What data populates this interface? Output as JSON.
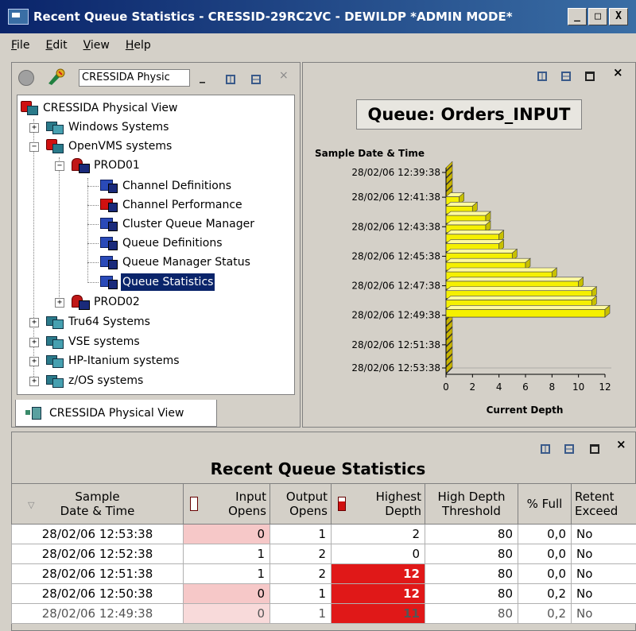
{
  "window": {
    "title": "Recent Queue Statistics - CRESSID-29RC2VC - DEWILDP   *ADMIN MODE*",
    "buttons": [
      "_",
      "□",
      "X"
    ]
  },
  "menu": [
    "File",
    "Edit",
    "View",
    "Help"
  ],
  "left_panel": {
    "view_selector": "CRESSIDA Physic",
    "tab_label": "CRESSIDA Physical View",
    "tree": [
      {
        "label": "CRESSIDA Physical View",
        "icon": "network-root-icon",
        "level": 0
      },
      {
        "label": "Windows Systems",
        "icon": "system-group-icon",
        "level": 1,
        "expander": "+"
      },
      {
        "label": "OpenVMS systems",
        "icon": "system-group-alert-icon",
        "level": 1,
        "expander": "−"
      },
      {
        "label": "PROD01",
        "icon": "queue-manager-icon",
        "level": 2,
        "expander": "−"
      },
      {
        "label": "Channel Definitions",
        "icon": "monitor-icon",
        "level": 3
      },
      {
        "label": "Channel Performance",
        "icon": "monitor-alert-icon",
        "level": 3
      },
      {
        "label": "Cluster Queue Manager",
        "icon": "monitor-icon",
        "level": 3
      },
      {
        "label": "Queue Definitions",
        "icon": "monitor-icon",
        "level": 3
      },
      {
        "label": "Queue Manager Status",
        "icon": "monitor-icon",
        "level": 3
      },
      {
        "label": "Queue Statistics",
        "icon": "monitor-icon",
        "level": 3,
        "selected": true
      },
      {
        "label": "PROD02",
        "icon": "queue-manager-icon",
        "level": 2,
        "expander": "+"
      },
      {
        "label": "Tru64 Systems",
        "icon": "system-group-icon",
        "level": 1,
        "expander": "+"
      },
      {
        "label": "VSE systems",
        "icon": "system-group-icon",
        "level": 1,
        "expander": "+"
      },
      {
        "label": "HP-Itanium systems",
        "icon": "system-group-icon",
        "level": 1,
        "expander": "+"
      },
      {
        "label": "z/OS systems",
        "icon": "system-group-icon",
        "level": 1,
        "expander": "+"
      }
    ]
  },
  "chart_data": {
    "type": "bar",
    "orientation": "horizontal",
    "title": "Queue: Orders_INPUT",
    "ylabel": "Sample Date & Time",
    "xlabel": "Current Depth",
    "categories": [
      "28/02/06 12:39:38",
      "28/02/06 12:41:38",
      "28/02/06 12:43:38",
      "28/02/06 12:45:38",
      "28/02/06 12:47:38",
      "28/02/06 12:49:38",
      "28/02/06 12:51:38",
      "28/02/06 12:53:38"
    ],
    "x_ticks": [
      0,
      2,
      4,
      6,
      8,
      10,
      12
    ],
    "xlim": [
      0,
      12
    ],
    "series": [
      {
        "values": [
          0,
          0,
          0,
          1,
          2,
          3,
          3,
          4,
          4,
          5,
          6,
          8,
          10,
          11,
          11,
          12,
          0,
          0,
          0,
          0,
          0,
          0
        ],
        "color": "#f5f000"
      }
    ],
    "bar_count_note": "",
    "grid": false,
    "style": "3d"
  },
  "table": {
    "title": "Recent Queue Statistics",
    "columns": [
      "Sample\nDate & Time",
      "Input\nOpens",
      "Output\nOpens",
      "Highest\nDepth",
      "High Depth\nThreshold",
      "% Full",
      "Retent\nExceed"
    ],
    "rows": [
      [
        "28/02/06 12:53:38",
        "0",
        "1",
        "2",
        "80",
        "0,0",
        "No"
      ],
      [
        "28/02/06 12:52:38",
        "1",
        "2",
        "0",
        "80",
        "0,0",
        "No"
      ],
      [
        "28/02/06 12:51:38",
        "1",
        "2",
        "12",
        "80",
        "0,0",
        "No"
      ],
      [
        "28/02/06 12:50:38",
        "0",
        "1",
        "12",
        "80",
        "0,2",
        "No"
      ],
      [
        "28/02/06 12:49:38",
        "0",
        "1",
        "11",
        "80",
        "0,2",
        "No"
      ]
    ],
    "highlight_color": "#e01818"
  }
}
